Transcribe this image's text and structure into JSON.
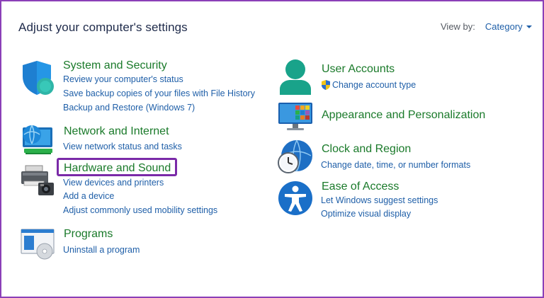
{
  "header": {
    "title": "Adjust your computer's settings",
    "view_by_label": "View by:",
    "view_by_value": "Category"
  },
  "left_categories": {
    "system_security": {
      "title": "System and Security",
      "links": [
        "Review your computer's status",
        "Save backup copies of your files with File History",
        "Backup and Restore (Windows 7)"
      ]
    },
    "network_internet": {
      "title": "Network and Internet",
      "links": [
        "View network status and tasks"
      ]
    },
    "hardware_sound": {
      "title": "Hardware and Sound",
      "links": [
        "View devices and printers",
        "Add a device",
        "Adjust commonly used mobility settings"
      ]
    },
    "programs": {
      "title": "Programs",
      "links": [
        "Uninstall a program"
      ]
    }
  },
  "right_categories": {
    "user_accounts": {
      "title": "User Accounts",
      "links": [
        "Change account type"
      ]
    },
    "appearance": {
      "title": "Appearance and Personalization",
      "links": []
    },
    "clock_region": {
      "title": "Clock and Region",
      "links": [
        "Change date, time, or number formats"
      ]
    },
    "ease_access": {
      "title": "Ease of Access",
      "links": [
        "Let Windows suggest settings",
        "Optimize visual display"
      ]
    }
  },
  "colors": {
    "frame_border": "#8b3fb8",
    "highlight": "#7a2aa8",
    "category_title": "#1a7a2a",
    "link": "#1f5fa8"
  }
}
